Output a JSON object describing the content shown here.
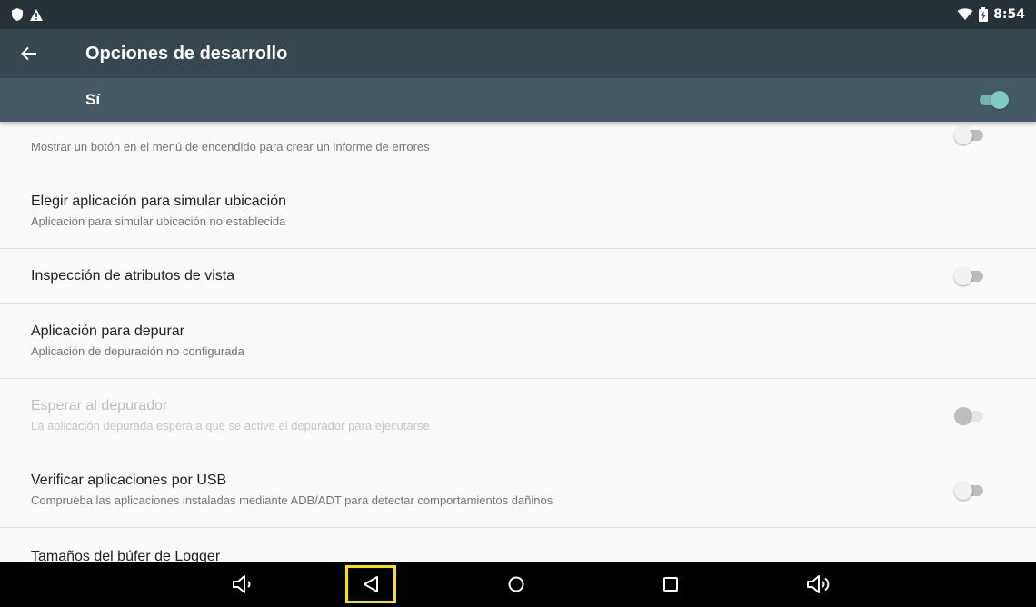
{
  "status_bar": {
    "time": "8:54",
    "icons_left": [
      "shield-icon",
      "warning-icon"
    ],
    "icons_right": [
      "wifi-icon",
      "battery-charging-icon"
    ]
  },
  "app_bar": {
    "title": "Opciones de desarrollo"
  },
  "master_switch": {
    "label": "Sí",
    "checked": true
  },
  "preferences": [
    {
      "title": "",
      "summary": "Mostrar un botón en el menú de encendido para crear un informe de errores",
      "switch": "off",
      "enabled": true
    },
    {
      "title": "Elegir aplicación para simular ubicación",
      "summary": "Aplicación para simular ubicación no establecida",
      "switch": null,
      "enabled": true
    },
    {
      "title": "Inspección de atributos de vista",
      "summary": "",
      "switch": "off",
      "enabled": true
    },
    {
      "title": "Aplicación para depurar",
      "summary": "Aplicación de depuración no configurada",
      "switch": null,
      "enabled": true
    },
    {
      "title": "Esperar al depurador",
      "summary": "La aplicación depurada espera a que se active el depurador para ejecutarse",
      "switch": "off",
      "enabled": false
    },
    {
      "title": "Verificar aplicaciones por USB",
      "summary": "Comprueba las aplicaciones instaladas mediante ADB/ADT para detectar comportamientos dañinos",
      "switch": "off",
      "enabled": true
    },
    {
      "title": "Tamaños del búfer de Logger",
      "summary": "",
      "switch": null,
      "enabled": true
    }
  ],
  "nav_bar": {
    "buttons": [
      "volume-down-icon",
      "back-icon",
      "home-icon",
      "recents-icon",
      "volume-up-icon"
    ],
    "highlighted": "back-icon",
    "highlight_color": "#f3e600"
  },
  "colors": {
    "status_bar": "#263238",
    "app_bar": "#37474f",
    "master_bar": "#455a64",
    "accent": "#80cbc4"
  }
}
